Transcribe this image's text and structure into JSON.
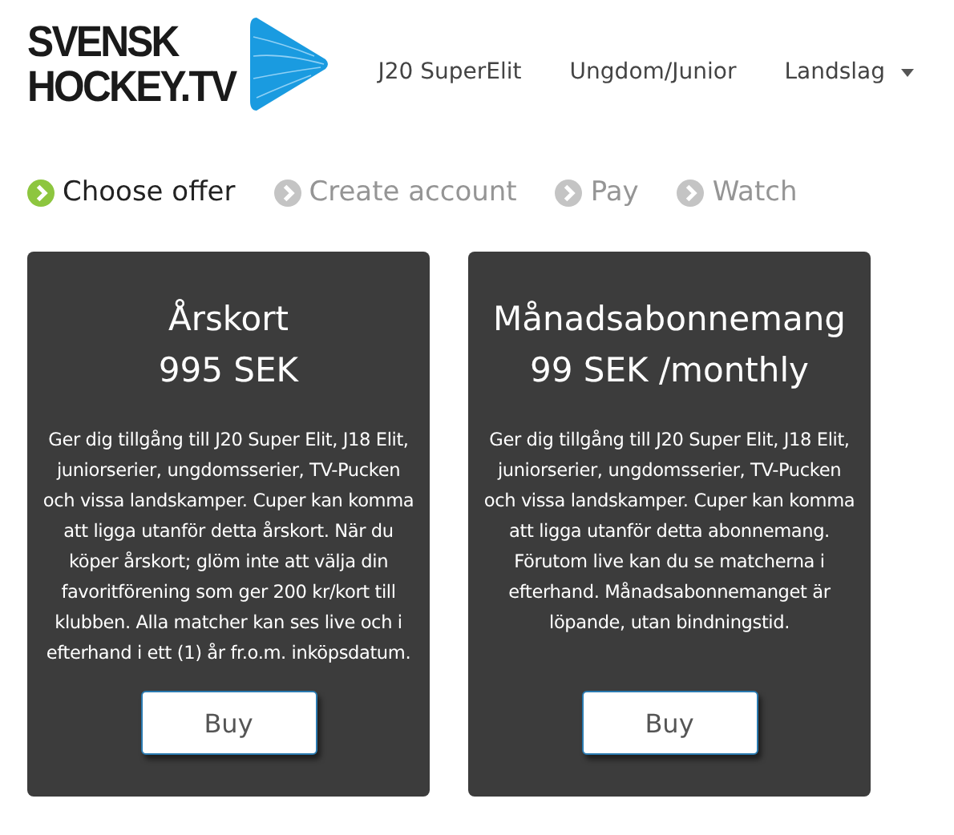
{
  "logo": {
    "line_1": "SVENSK",
    "line_2": "HOCKEY.TV"
  },
  "nav": [
    {
      "label": "J20 SuperElit",
      "kind": "link"
    },
    {
      "label": "Ungdom/Junior",
      "kind": "link"
    },
    {
      "label": "Landslag",
      "kind": "dropdown"
    }
  ],
  "steps": [
    {
      "label": "Choose offer",
      "selected": true
    },
    {
      "label": "Create account",
      "selected": false
    },
    {
      "label": "Pay",
      "selected": false
    },
    {
      "label": "Watch",
      "selected": false
    }
  ],
  "offers": [
    {
      "title": "Årskort",
      "price": "995 SEK",
      "description": "Ger dig tillgång till J20 Super Elit, J18 Elit, juniorserier, ungdomsserier, TV-Pucken och vissa landskamper. Cuper kan komma att ligga utanför detta årskort. När du köper årskort; glöm inte att välja din favoritförening som ger 200 kr/kort till klubben. Alla matcher kan ses live och i efterhand i ett (1) år fr.o.m. inköpsdatum.",
      "button": "Buy"
    },
    {
      "title": "Månadsabonnemang",
      "price": "99 SEK /monthly",
      "description": "Ger dig tillgång till J20 Super Elit, J18 Elit, juniorserier, ungdomsserier, TV-Pucken och vissa landskamper. Cuper kan komma att ligga utanför detta abonnemang. Förutom live kan du se matcherna i efterhand. Månadsabonnemanget är löpande, utan bindningstid.",
      "button": "Buy"
    }
  ]
}
